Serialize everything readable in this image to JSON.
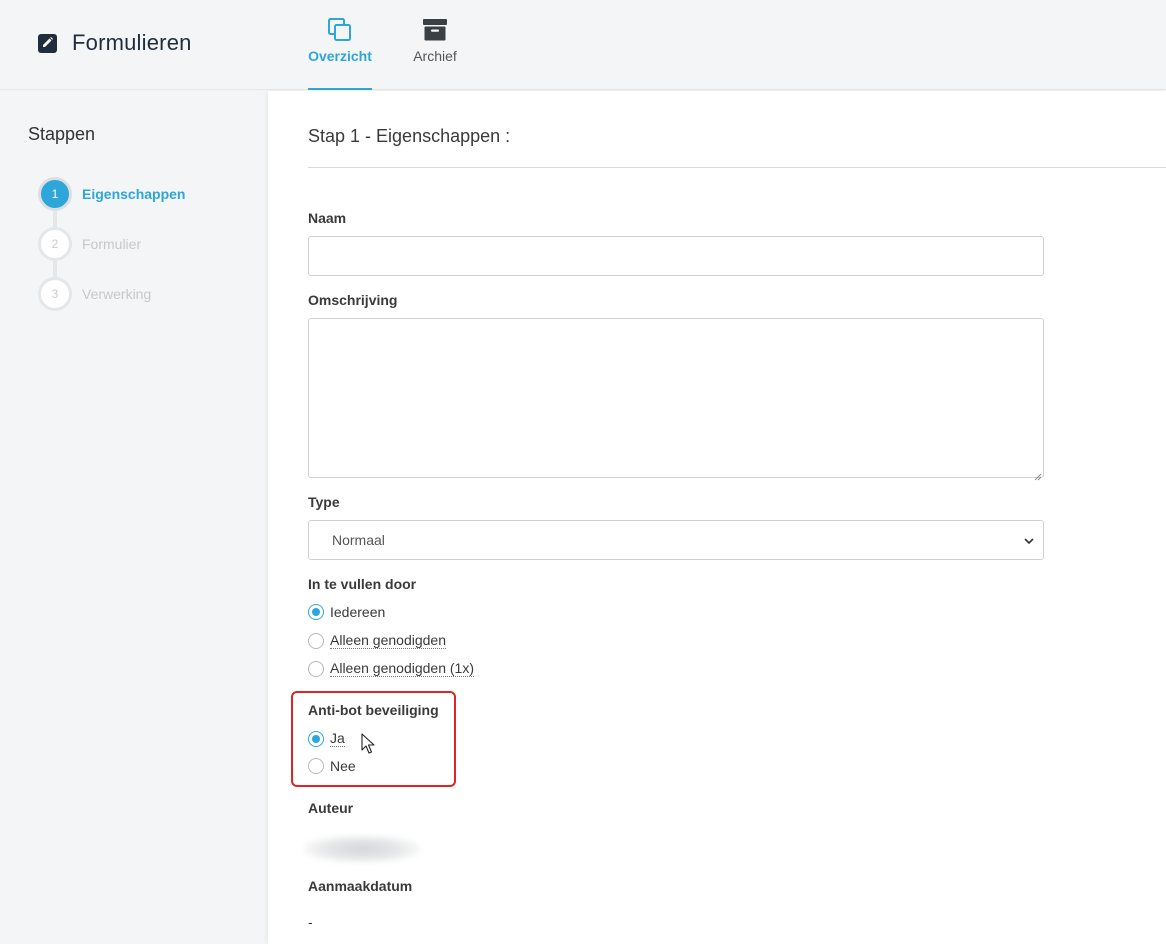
{
  "app": {
    "title": "Formulieren",
    "brand_icon": "edit-icon"
  },
  "tabs": [
    {
      "label": "Overzicht",
      "icon": "copy-icon",
      "active": true
    },
    {
      "label": "Archief",
      "icon": "archive-box-icon",
      "active": false
    }
  ],
  "sidebar": {
    "title": "Stappen",
    "steps": [
      {
        "number": "1",
        "label": "Eigenschappen",
        "active": true
      },
      {
        "number": "2",
        "label": "Formulier",
        "active": false
      },
      {
        "number": "3",
        "label": "Verwerking",
        "active": false
      }
    ]
  },
  "main": {
    "title": "Stap 1 - Eigenschappen :",
    "fields": {
      "naam": {
        "label": "Naam",
        "value": ""
      },
      "omschrijving": {
        "label": "Omschrijving",
        "value": ""
      },
      "type": {
        "label": "Type",
        "value": "Normaal"
      }
    },
    "fill_in_by": {
      "label": "In te vullen door",
      "options": [
        {
          "label": "Iedereen",
          "checked": true
        },
        {
          "label": "Alleen genodigden",
          "checked": false
        },
        {
          "label": "Alleen genodigden (1x)",
          "checked": false
        }
      ]
    },
    "antibot": {
      "label": "Anti-bot beveiliging",
      "options": [
        {
          "label": "Ja",
          "checked": true
        },
        {
          "label": "Nee",
          "checked": false
        }
      ]
    },
    "author": {
      "label": "Auteur"
    },
    "created": {
      "label": "Aanmaakdatum",
      "value": "-"
    }
  },
  "colors": {
    "accent": "#2ea6d9",
    "highlight": "#e02424",
    "brand": "#1f2d3d"
  }
}
